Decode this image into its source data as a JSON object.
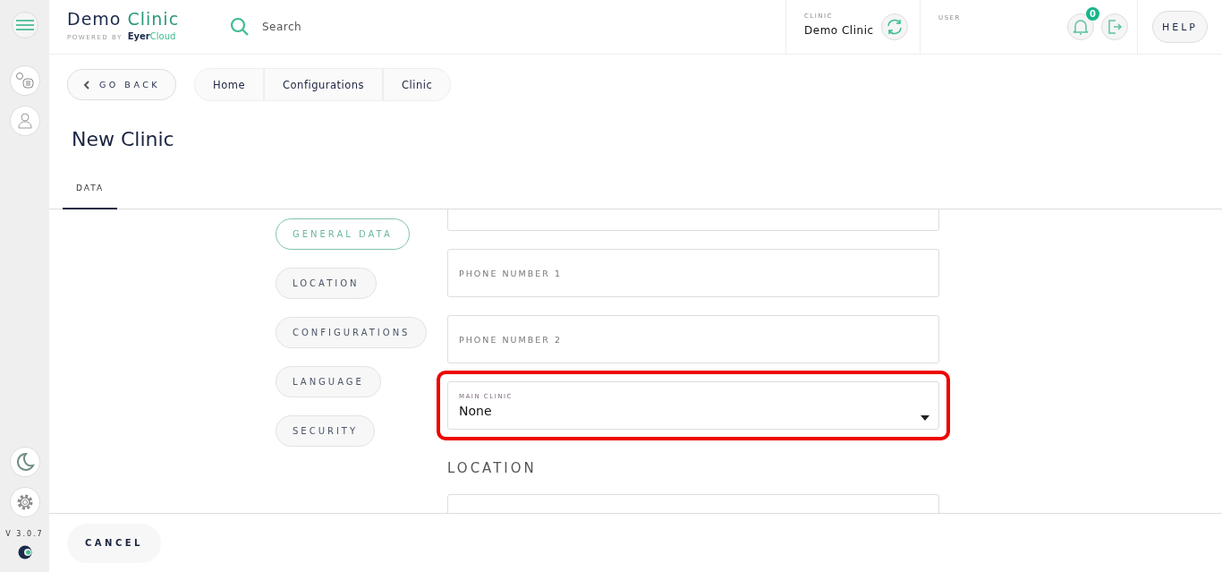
{
  "brand": {
    "name_first": "Demo",
    "name_second": "Clinic",
    "powered_by": "POWERED BY",
    "maker_first": "Eyer",
    "maker_second": "Cloud"
  },
  "search": {
    "placeholder": "Search"
  },
  "clinic": {
    "label": "CLINIC",
    "value": "Demo Clinic"
  },
  "user": {
    "label": "USER"
  },
  "notifications": {
    "count": "0"
  },
  "help_button": "HELP",
  "version": "V 3.0.7",
  "go_back": "GO BACK",
  "breadcrumb": [
    "Home",
    "Configurations",
    "Clinic"
  ],
  "page_title": "New Clinic",
  "tabs": [
    {
      "label": "DATA",
      "selected": true
    }
  ],
  "sections": [
    {
      "label": "GENERAL DATA",
      "selected": true
    },
    {
      "label": "LOCATION",
      "selected": false
    },
    {
      "label": "CONFIGURATIONS",
      "selected": false
    },
    {
      "label": "LANGUAGE",
      "selected": false
    },
    {
      "label": "SECURITY",
      "selected": false
    }
  ],
  "fields": [
    {
      "kind": "text",
      "placeholder": "PHONE NUMBER 1"
    },
    {
      "kind": "text",
      "placeholder": "PHONE NUMBER 2"
    },
    {
      "kind": "select",
      "label": "MAIN CLINIC",
      "value": "None",
      "highlighted": true
    }
  ],
  "location_heading": "LOCATION",
  "cancel_button": "CANCEL"
}
